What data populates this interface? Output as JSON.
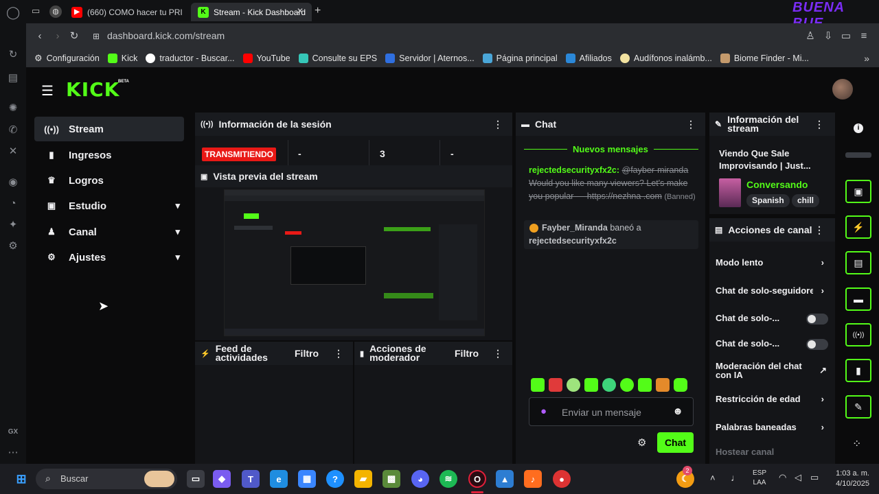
{
  "browser": {
    "tabs": [
      {
        "label": "(660) COMO hacer tu PRI",
        "active": false
      },
      {
        "label": "Stream - Kick Dashboard",
        "active": true
      }
    ],
    "url": "dashboard.kick.com/stream",
    "overlay_logo": "BUENA BUE",
    "bookmarks": [
      {
        "label": "Configuración",
        "icon": "gear-icon"
      },
      {
        "label": "Kick",
        "icon": "kick-icon"
      },
      {
        "label": "traductor - Buscar...",
        "icon": "google-icon"
      },
      {
        "label": "YouTube",
        "icon": "youtube-icon"
      },
      {
        "label": "Consulte su EPS",
        "icon": "shield-icon"
      },
      {
        "label": "Servidor | Aternos...",
        "icon": "server-icon"
      },
      {
        "label": "Página principal",
        "icon": "home-icon"
      },
      {
        "label": "Afiliados",
        "icon": "link-icon"
      },
      {
        "label": "Audífonos inalámb...",
        "icon": "headphones-icon"
      },
      {
        "label": "Biome Finder - Mi...",
        "icon": "map-icon"
      }
    ]
  },
  "kick": {
    "logo": "KICK",
    "logo_badge": "BETA",
    "accent": "#53fc18",
    "sidebar": [
      {
        "label": "Stream",
        "icon": "broadcast-icon",
        "active": true
      },
      {
        "label": "Ingresos",
        "icon": "chart-icon"
      },
      {
        "label": "Logros",
        "icon": "trophy-icon"
      },
      {
        "label": "Estudio",
        "icon": "studio-icon",
        "expandable": true
      },
      {
        "label": "Canal",
        "icon": "users-icon",
        "expandable": true
      },
      {
        "label": "Ajustes",
        "icon": "gear-icon",
        "expandable": true
      }
    ],
    "session": {
      "title": "Información de la sesión",
      "status": "TRANSMITIENDO",
      "stat1": "-",
      "stat2": "3",
      "stat3": "-"
    },
    "preview": {
      "title": "Vista previa del stream"
    },
    "activity": {
      "title": "Feed de actividades",
      "filter": "Filtro"
    },
    "moderator": {
      "title": "Acciones de moderador",
      "filter": "Filtro"
    },
    "chat": {
      "title": "Chat",
      "new_messages": "Nuevos mensajes",
      "msg_user": "rejectedsecurityxfx2c:",
      "msg_mention": "@fayber-miranda",
      "msg_text": "Would you like many viewers? Let's make you popular — https://nezhna .com",
      "msg_banned": "(Banned)",
      "ban_actor": "Fayber_Miranda",
      "ban_verb": "baneó a",
      "ban_target": "rejectedsecurityxfx2c",
      "input_placeholder": "Enviar un mensaje",
      "send": "Chat"
    },
    "stream_info": {
      "title": "Información del stream",
      "stream_title": "Viendo Que Sale Improvisando | Just...",
      "category": "Conversando",
      "tags": [
        "Spanish",
        "chill"
      ]
    },
    "channel_actions": {
      "title": "Acciones de canal",
      "items": [
        {
          "label": "Modo lento",
          "control": "chevron"
        },
        {
          "label": "Chat de solo-seguidores",
          "control": "chevron"
        },
        {
          "label": "Chat de solo-...",
          "control": "toggle"
        },
        {
          "label": "Chat de solo-...",
          "control": "toggle"
        },
        {
          "label": "Moderación del chat con IA",
          "control": "external"
        },
        {
          "label": "Restricción de edad",
          "control": "chevron"
        },
        {
          "label": "Palabras baneadas",
          "control": "chevron"
        },
        {
          "label": "Hostear canal",
          "control": "none"
        }
      ]
    }
  },
  "taskbar": {
    "search_placeholder": "Buscar",
    "lang_line1": "ESP",
    "lang_line2": "LAA",
    "time": "1:03 a. m.",
    "date": "4/10/2025",
    "notification_count": "2"
  },
  "opera_rail": {
    "gx_label": "GX"
  }
}
